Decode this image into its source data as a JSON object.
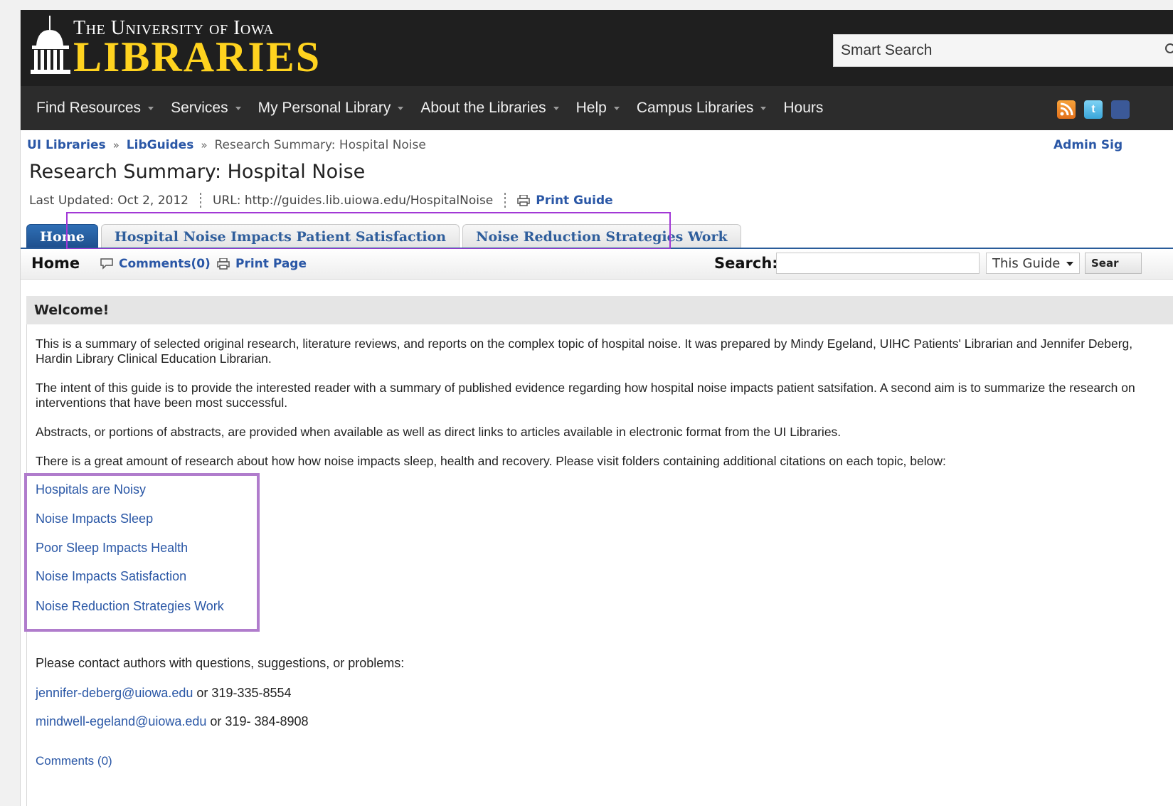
{
  "header": {
    "logo_top": "The University of Iowa",
    "logo_main": "LIBRARIES",
    "search_placeholder": "Smart Search"
  },
  "nav": {
    "items": [
      {
        "label": "Find Resources"
      },
      {
        "label": "Services"
      },
      {
        "label": "My Personal Library"
      },
      {
        "label": "About the Libraries"
      },
      {
        "label": "Help"
      },
      {
        "label": "Campus Libraries"
      },
      {
        "label": "Hours"
      }
    ]
  },
  "breadcrumb": {
    "items": [
      "UI Libraries",
      "LibGuides"
    ],
    "separator": "»",
    "current": "Research Summary: Hospital Noise"
  },
  "admin_label": "Admin Sig",
  "page_title": "Research Summary: Hospital Noise",
  "meta": {
    "last_updated": "Last Updated: Oct 2, 2012",
    "url": "URL: http://guides.lib.uiowa.edu/HospitalNoise",
    "print_guide": "Print Guide"
  },
  "tabs": [
    {
      "label": "Home"
    },
    {
      "label": "Hospital Noise Impacts Patient Satisfaction"
    },
    {
      "label": "Noise Reduction Strategies Work"
    }
  ],
  "subbar": {
    "home": "Home",
    "comments": "Comments(0)",
    "print_page": "Print Page",
    "search_label": "Search:",
    "scope": "This Guide",
    "search_button": "Sear"
  },
  "box": {
    "title": "Welcome!",
    "paragraphs": [
      "This is a summary of selected original research, literature reviews, and reports on the complex topic of hospital noise. It was prepared by Mindy Egeland, UIHC Patients' Librarian and Jennifer Deberg, Hardin Library Clinical Education Librarian.",
      "The intent of this guide is to provide the interested reader with a summary of published evidence regarding how hospital noise impacts patient satsifation. A second aim is to summarize the research on interventions that have been most successful.",
      "Abstracts, or portions of abstracts, are provided when available as well as direct links to articles available in electronic format from the UI Libraries.",
      "There is a great amount of research about how how noise impacts sleep, health and recovery. Please visit folders containing additional  citations on each topic, below:"
    ],
    "links": [
      "Hospitals are Noisy",
      "Noise Impacts Sleep",
      "Poor Sleep Impacts Health",
      "Noise Impacts Satisfaction",
      "Noise Reduction Strategies Work"
    ],
    "contact_intro": "Please contact authors with questions, suggestions, or problems:",
    "contacts": [
      {
        "email": "jennifer-deberg@uiowa.edu",
        "phone": " or 319-335-8554"
      },
      {
        "email": "mindwell-egeland@uiowa.edu",
        "phone": " or 319- 384-8908"
      }
    ],
    "comments_footer": "Comments (0)"
  },
  "colors": {
    "header_bg": "#1f1f1f",
    "nav_bg": "#2c2c2c",
    "logo_gold": "#ffd31f",
    "link_blue": "#2a57a6",
    "highlight_purple": "#a238d6"
  }
}
